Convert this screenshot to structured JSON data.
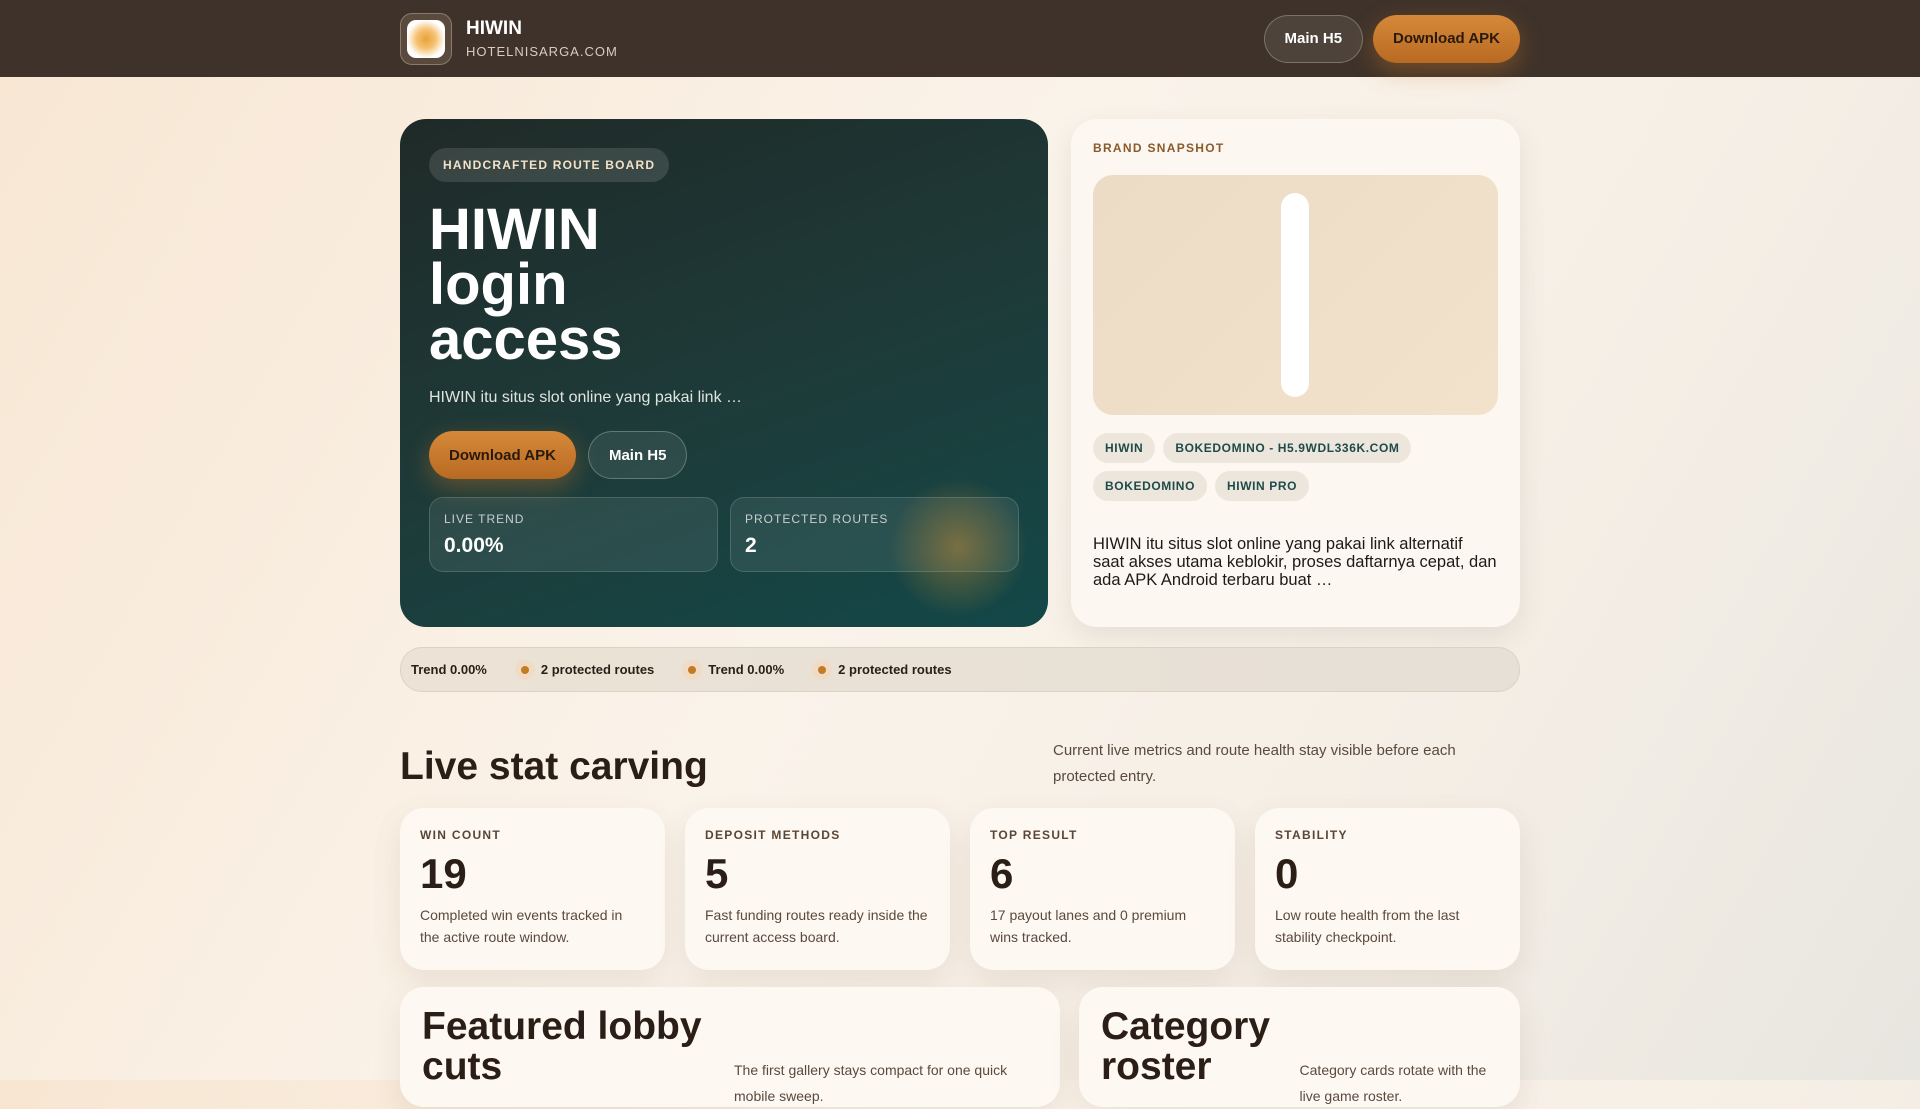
{
  "header": {
    "brand": "HIWIN",
    "domain": "HOTELNISARGA.COM",
    "logo_text": "HIWIN",
    "main_h5": "Main H5",
    "download": "Download APK"
  },
  "hero": {
    "pill": "HANDCRAFTED ROUTE BOARD",
    "title": "HIWIN login access",
    "desc": "HIWIN itu situs slot online yang pakai link …",
    "download": "Download APK",
    "main_h5": "Main H5",
    "metrics": [
      {
        "label": "LIVE TREND",
        "value": "0.00%"
      },
      {
        "label": "PROTECTED ROUTES",
        "value": "2"
      }
    ]
  },
  "snapshot": {
    "label": "BRAND SNAPSHOT",
    "tags": [
      "HIWIN",
      "BOKEDOMINO - H5.9WDL336K.COM",
      "BOKEDOMINO",
      "HIWIN PRO"
    ],
    "desc": "HIWIN itu situs slot online yang pakai link alternatif saat akses utama keblokir, proses daftarnya cepat, dan ada APK Android terbaru buat …"
  },
  "ticker": [
    "Trend 0.00%",
    "2 protected routes",
    "Trend 0.00%",
    "2 protected routes"
  ],
  "stats_section": {
    "title": "Live stat carving",
    "desc": "Current live metrics and route health stay visible before each protected entry.",
    "cards": [
      {
        "label": "WIN COUNT",
        "value": "19",
        "desc": "Completed win events tracked in the active route window."
      },
      {
        "label": "DEPOSIT METHODS",
        "value": "5",
        "desc": "Fast funding routes ready inside the current access board."
      },
      {
        "label": "TOP RESULT",
        "value": "6",
        "desc": "17 payout lanes and 0 premium wins tracked."
      },
      {
        "label": "STABILITY",
        "value": "0",
        "desc": "Low route health from the last stability checkpoint."
      }
    ]
  },
  "featured": {
    "title": "Featured lobby cuts",
    "desc": "The first gallery stays compact for one quick mobile sweep."
  },
  "category": {
    "title": "Category roster",
    "desc": "Category cards rotate with the live game roster."
  }
}
